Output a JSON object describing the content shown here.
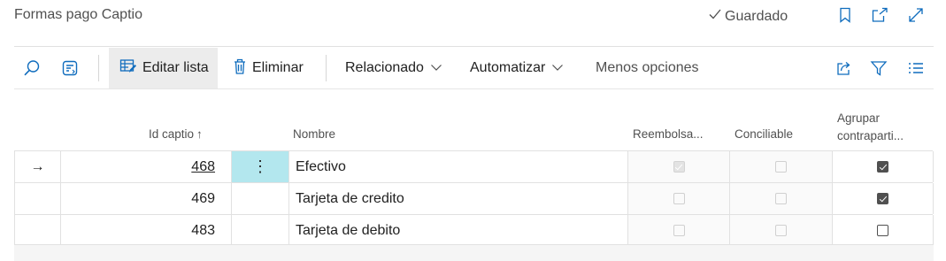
{
  "page": {
    "title": "Formas pago Captio",
    "saved_label": "Guardado"
  },
  "header_icons": [
    "bookmark-icon",
    "open-new-window-icon",
    "expand-icon"
  ],
  "toolbar": {
    "search_icon": "search-icon",
    "filter_pane_icon": "filter-pane-icon",
    "edit_list_label": "Editar lista",
    "delete_label": "Eliminar",
    "related_label": "Relacionado",
    "automate_label": "Automatizar",
    "fewer_options_label": "Menos opciones",
    "right_icons": [
      "share-icon",
      "filter-icon",
      "list-view-icon"
    ]
  },
  "table": {
    "columns": {
      "id": "Id captio",
      "id_sort": "↑",
      "name": "Nombre",
      "reimbursable": "Reembolsa...",
      "reconcilable": "Conciliable",
      "group_line1": "Agrupar",
      "group_line2": "contraparti..."
    },
    "rows": [
      {
        "id": "468",
        "name": "Efectivo",
        "reimbursable": true,
        "reconcilable": false,
        "group": true,
        "selected": true
      },
      {
        "id": "469",
        "name": "Tarjeta de credito",
        "reimbursable": false,
        "reconcilable": false,
        "group": true,
        "selected": false
      },
      {
        "id": "483",
        "name": "Tarjeta de debito",
        "reimbursable": false,
        "reconcilable": false,
        "group": false,
        "selected": false
      }
    ],
    "row_marker": "→",
    "row_menu": "⋮"
  },
  "colors": {
    "accent": "#0f6cbd",
    "selected_cell": "#b3e7ee",
    "toolbar_active": "#ececec"
  }
}
